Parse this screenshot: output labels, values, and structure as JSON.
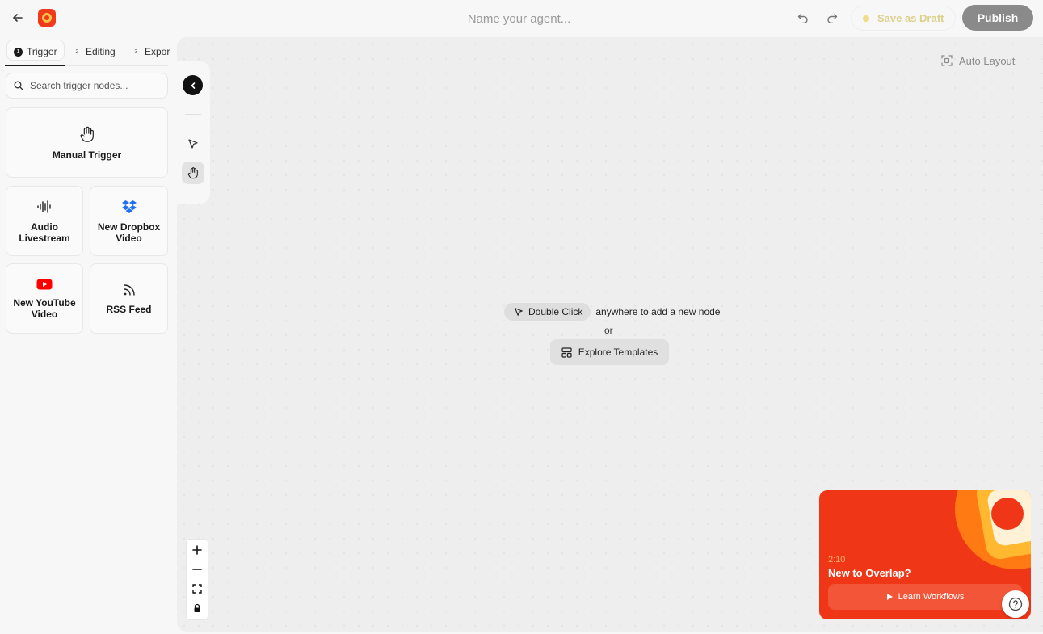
{
  "colors": {
    "brand": "#ef3b1c",
    "publish_bg": "#8a8a8a",
    "draft_dot": "#f0dc84",
    "promo_bg": "#ef3718"
  },
  "header": {
    "back_icon": "arrow-left-icon",
    "logo": "overlap-logo",
    "agent_name_placeholder": "Name your agent...",
    "undo_icon": "undo-icon",
    "redo_icon": "redo-icon",
    "save_draft_label": "Save as Draft",
    "publish_label": "Publish"
  },
  "sidebar": {
    "tabs": [
      {
        "num": "1",
        "label": "Trigger",
        "active": true
      },
      {
        "num": "2",
        "label": "Editing",
        "active": false
      },
      {
        "num": "3",
        "label": "Expor",
        "active": false
      }
    ],
    "search_placeholder": "Search trigger nodes...",
    "nodes": [
      {
        "label": "Manual Trigger",
        "icon": "hand-icon"
      },
      {
        "label": "Audio Livestream",
        "icon": "audio-waveform-icon"
      },
      {
        "label": "New Dropbox Video",
        "icon": "dropbox-icon"
      },
      {
        "label": "New YouTube Video",
        "icon": "youtube-icon"
      },
      {
        "label": "RSS Feed",
        "icon": "rss-icon"
      }
    ]
  },
  "canvas": {
    "auto_layout_label": "Auto Layout",
    "double_click_label": "Double Click",
    "hint_text": "anywhere to add a new node",
    "or_text": "or",
    "explore_label": "Explore Templates",
    "zoom_controls": [
      "zoom-in-icon",
      "zoom-out-icon",
      "fit-view-icon",
      "lock-icon"
    ]
  },
  "promo": {
    "duration": "2:10",
    "title": "New to Overlap?",
    "button_label": "Learn Workflows"
  }
}
